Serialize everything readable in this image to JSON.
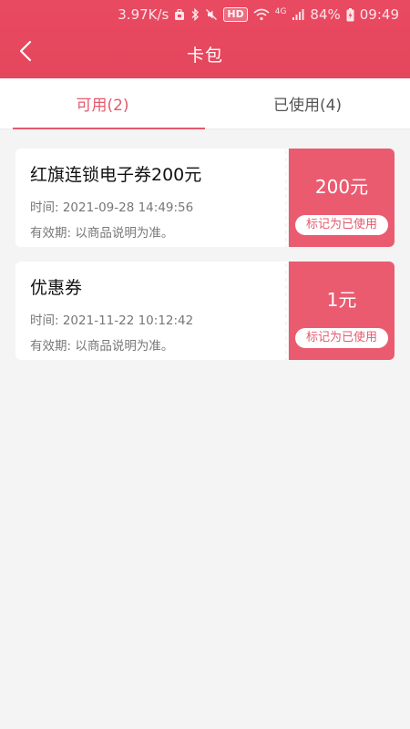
{
  "status_bar": {
    "speed": "3.97K/s",
    "hd": "HD",
    "network": "4G",
    "battery": "84%",
    "time": "09:49"
  },
  "navbar": {
    "title": "卡包"
  },
  "tabs": [
    {
      "label": "可用(2)",
      "active": true
    },
    {
      "label": "已使用(4)",
      "active": false
    }
  ],
  "coupons": [
    {
      "title": "红旗连锁电子券200元",
      "time": "时间: 2021-09-28 14:49:56",
      "validity": "有效期: 以商品说明为准。",
      "amount": "200元",
      "action": "标记为已使用"
    },
    {
      "title": "优惠券",
      "time": "时间: 2021-11-22 10:12:42",
      "validity": "有效期: 以商品说明为准。",
      "amount": "1元",
      "action": "标记为已使用"
    }
  ],
  "colors": {
    "header": "#e94a62",
    "accent": "#e45a6d",
    "coupon_right": "#ea5b70",
    "background": "#f4f4f4"
  }
}
